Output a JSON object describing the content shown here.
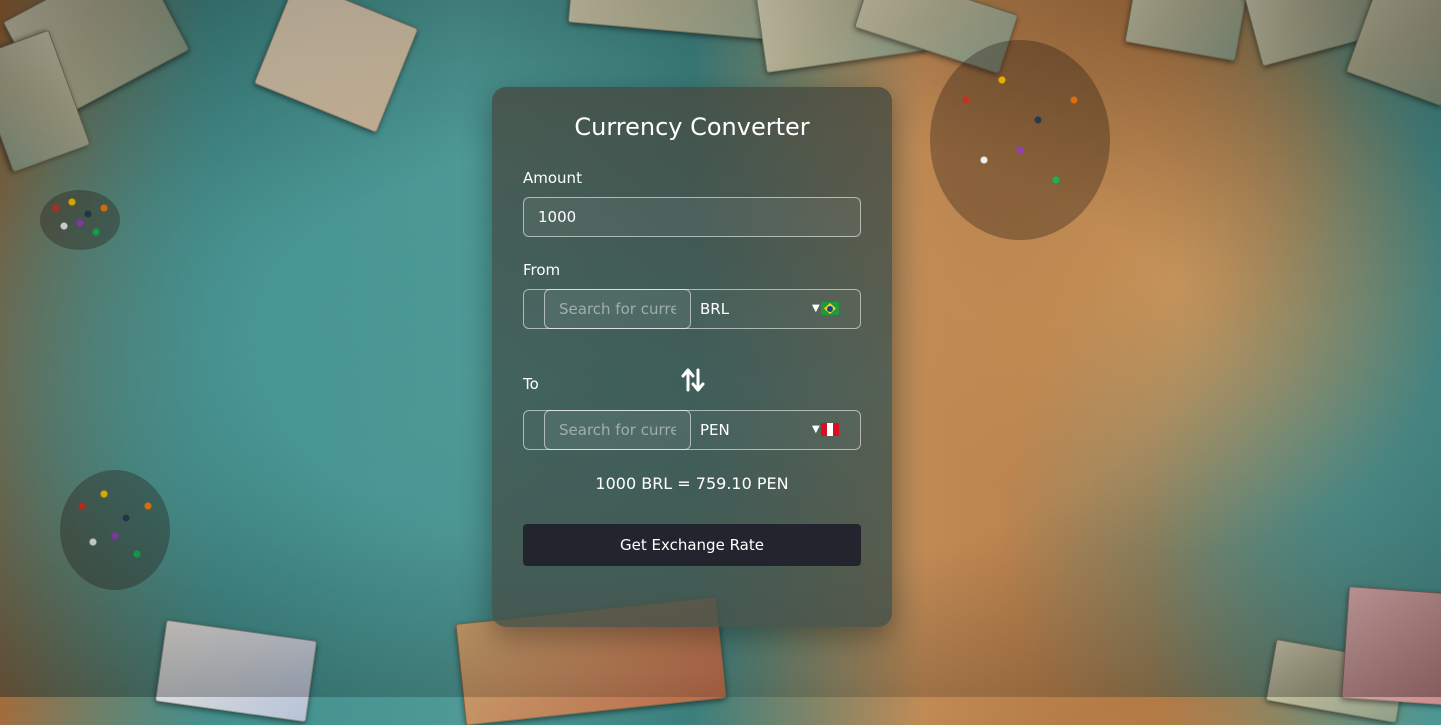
{
  "converter": {
    "title": "Currency Converter",
    "amount": {
      "label": "Amount",
      "value": "1000"
    },
    "from": {
      "label": "From",
      "search_placeholder": "Search for currency",
      "selected_code": "BRL",
      "flag": "brazil-flag"
    },
    "to": {
      "label": "To",
      "search_placeholder": "Search for currency",
      "selected_code": "PEN",
      "flag": "peru-flag"
    },
    "swap_icon": "swap-arrows-icon",
    "result_text": "1000 BRL = 759.10 PEN",
    "button_label": "Get Exchange Rate"
  },
  "colors": {
    "button_bg": "#23252e",
    "text": "#ffffff"
  }
}
